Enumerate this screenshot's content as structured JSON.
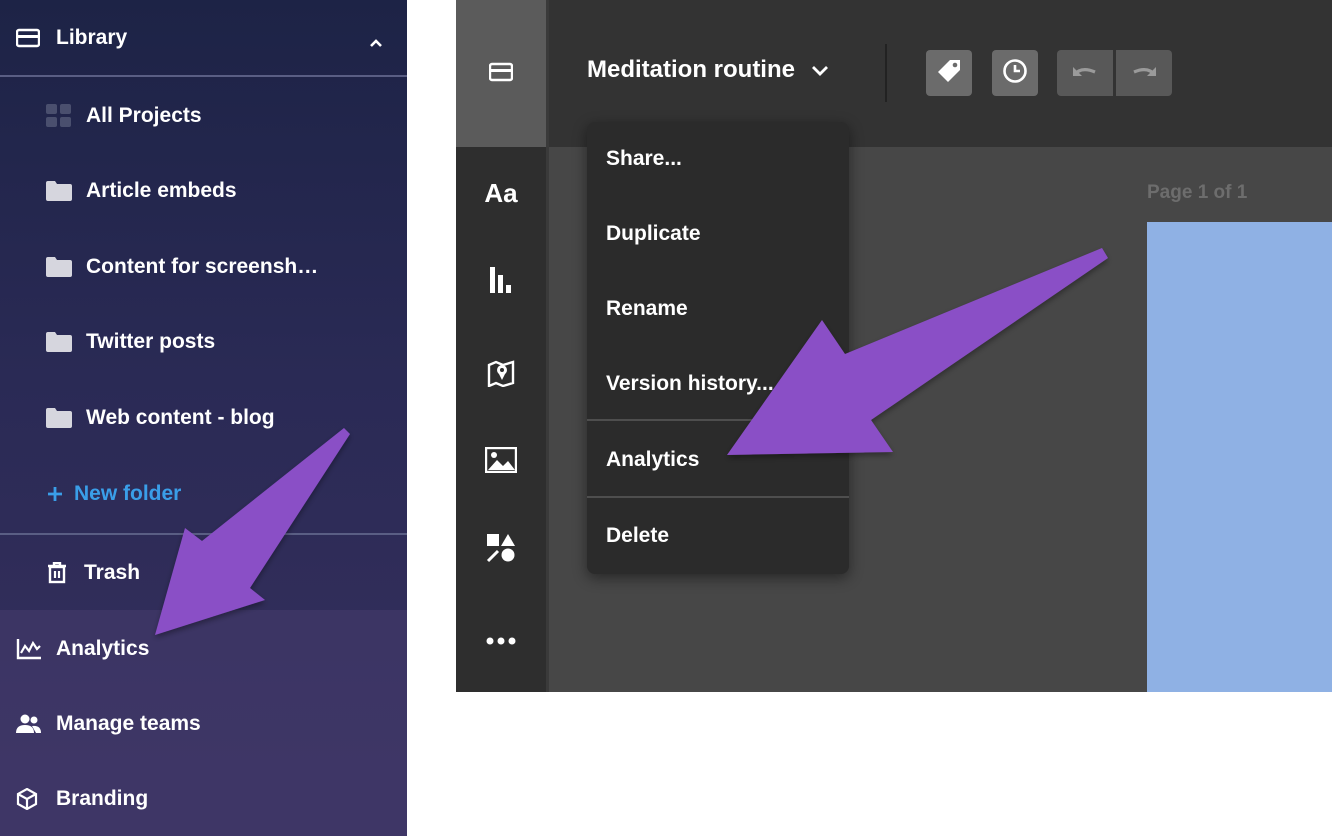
{
  "sidebar": {
    "library_label": "Library",
    "items": [
      {
        "label": "All Projects",
        "icon": "grid-icon"
      },
      {
        "label": "Article embeds",
        "icon": "folder-icon"
      },
      {
        "label": "Content for screensh…",
        "icon": "folder-icon"
      },
      {
        "label": "Twitter posts",
        "icon": "folder-icon"
      },
      {
        "label": "Web content - blog",
        "icon": "folder-icon"
      }
    ],
    "new_folder_label": "New folder",
    "trash_label": "Trash",
    "analytics_label": "Analytics",
    "manage_teams_label": "Manage teams",
    "branding_label": "Branding"
  },
  "editor": {
    "doc_title": "Meditation routine",
    "page_label": "Page 1 of 1",
    "rail_icons": [
      "inbox-icon",
      "text-icon",
      "chart-icon",
      "map-icon",
      "image-icon",
      "shapes-icon",
      "more-icon"
    ],
    "rail_text_icon_label": "Aa"
  },
  "menu": {
    "items": [
      "Share...",
      "Duplicate",
      "Rename",
      "Version history...",
      "Analytics",
      "Delete"
    ]
  },
  "colors": {
    "annotation_arrow": "#8a4fc6",
    "link_blue": "#3a9ee8",
    "canvas_blue": "#8fb1e4"
  }
}
